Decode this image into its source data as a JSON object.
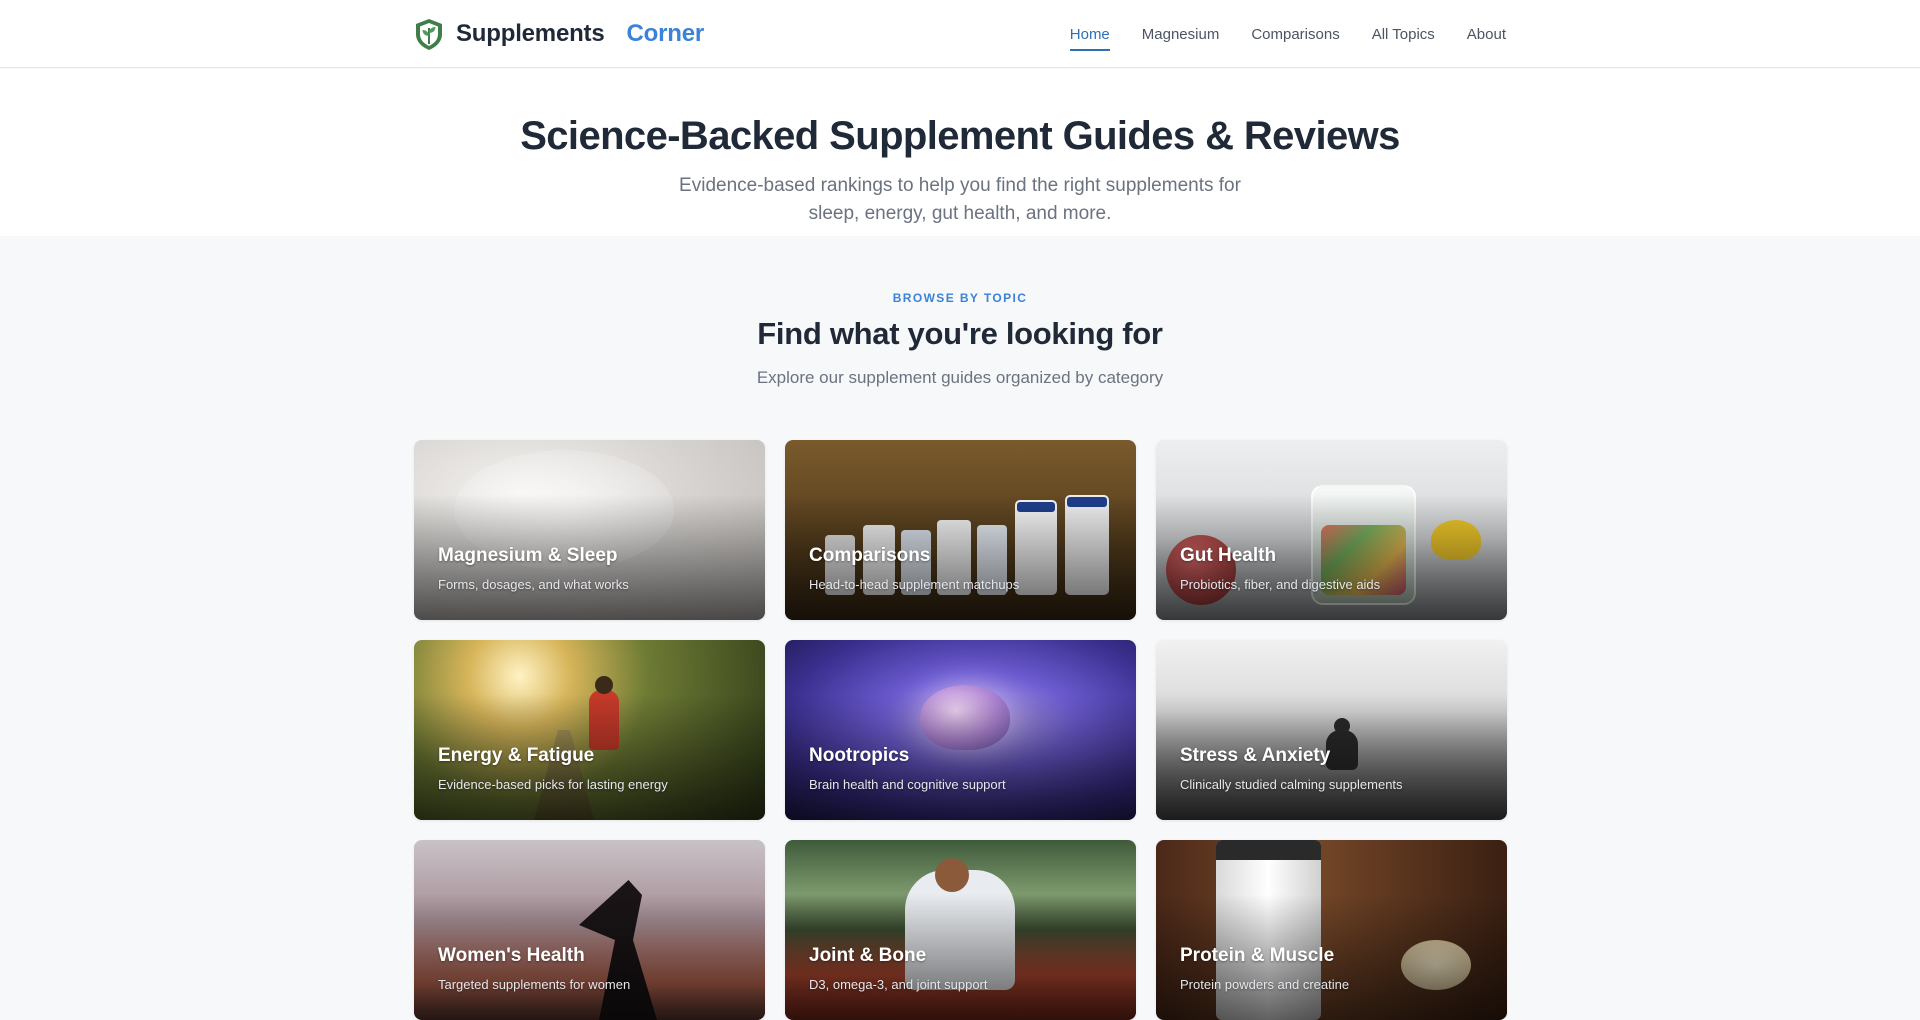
{
  "header": {
    "brand_name": "Supplements",
    "brand_accent": "Corner",
    "logo_icon": "leaf-shield-icon",
    "nav": [
      {
        "label": "Home",
        "active": true
      },
      {
        "label": "Magnesium",
        "active": false
      },
      {
        "label": "Comparisons",
        "active": false
      },
      {
        "label": "All Topics",
        "active": false
      },
      {
        "label": "About",
        "active": false
      }
    ]
  },
  "hero": {
    "title": "Science-Backed Supplement Guides & Reviews",
    "subtitle": "Evidence-based rankings to help you find the right supplements for sleep, energy, gut health, and more."
  },
  "topics": {
    "eyebrow": "BROWSE BY TOPIC",
    "title": "Find what you're looking for",
    "subtitle": "Explore our supplement guides organized by category",
    "cards": [
      {
        "title": "Magnesium & Sleep",
        "description": "Forms, dosages, and what works"
      },
      {
        "title": "Comparisons",
        "description": "Head-to-head supplement matchups"
      },
      {
        "title": "Gut Health",
        "description": "Probiotics, fiber, and digestive aids"
      },
      {
        "title": "Energy & Fatigue",
        "description": "Evidence-based picks for lasting energy"
      },
      {
        "title": "Nootropics",
        "description": "Brain health and cognitive support"
      },
      {
        "title": "Stress & Anxiety",
        "description": "Clinically studied calming supplements"
      },
      {
        "title": "Women's Health",
        "description": "Targeted supplements for women"
      },
      {
        "title": "Joint & Bone",
        "description": "D3, omega-3, and joint support"
      },
      {
        "title": "Protein & Muscle",
        "description": "Protein powders and creatine"
      }
    ]
  },
  "colors": {
    "accent": "#3b82d8",
    "nav_active": "#2f6fb8",
    "heading": "#1f2937",
    "muted": "#6b7280",
    "section_bg": "#f6f8fa"
  }
}
